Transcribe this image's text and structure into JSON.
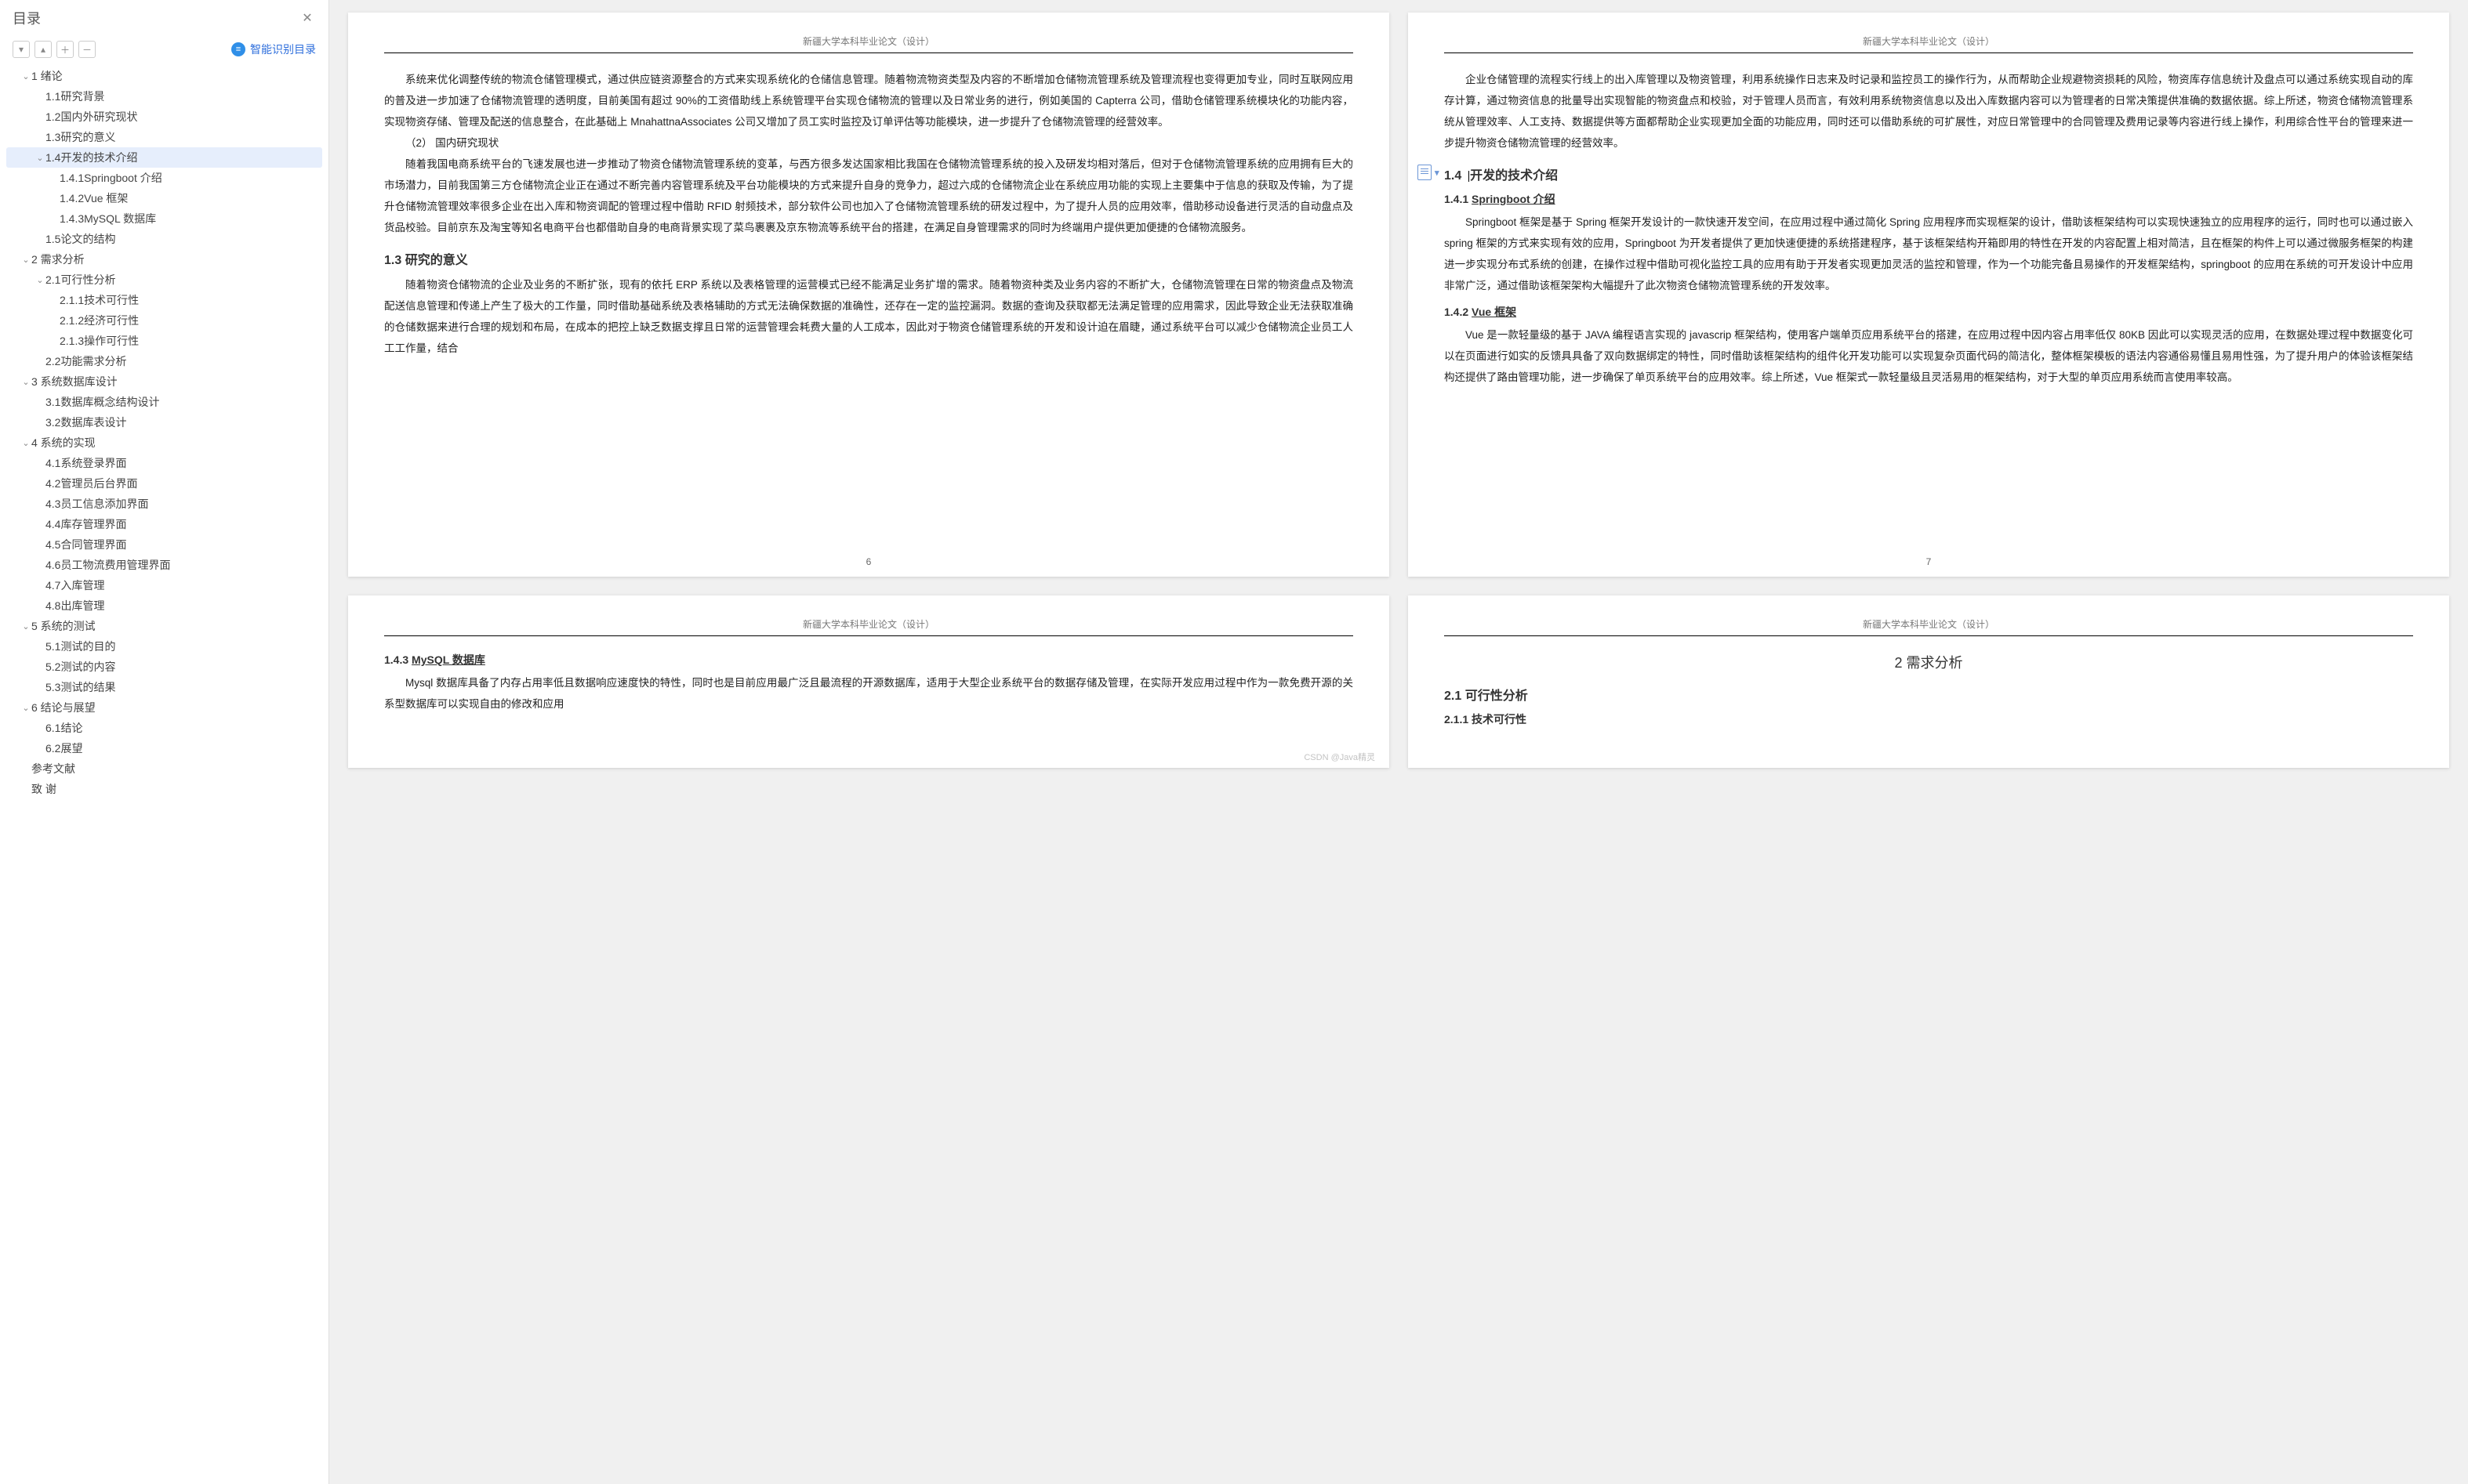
{
  "sidebar": {
    "title": "目录",
    "smart_toc": "智能识别目录",
    "tool_icons": [
      "collapse-all",
      "expand-all",
      "add",
      "remove"
    ],
    "items": [
      {
        "label": "1  绪论",
        "level": 0,
        "caret": "down"
      },
      {
        "label": "1.1研究背景",
        "level": 1
      },
      {
        "label": "1.2国内外研究现状",
        "level": 1
      },
      {
        "label": "1.3研究的意义",
        "level": 1
      },
      {
        "label": "1.4开发的技术介绍",
        "level": 1,
        "caret": "down",
        "selected": true
      },
      {
        "label": "1.4.1Springboot 介绍",
        "level": 2
      },
      {
        "label": "1.4.2Vue 框架",
        "level": 2
      },
      {
        "label": "1.4.3MySQL 数据库",
        "level": 2
      },
      {
        "label": "1.5论文的结构",
        "level": 1
      },
      {
        "label": "2  需求分析",
        "level": 0,
        "caret": "down"
      },
      {
        "label": "2.1可行性分析",
        "level": 1,
        "caret": "down"
      },
      {
        "label": "2.1.1技术可行性",
        "level": 2
      },
      {
        "label": "2.1.2经济可行性",
        "level": 2
      },
      {
        "label": "2.1.3操作可行性",
        "level": 2
      },
      {
        "label": "2.2功能需求分析",
        "level": 1
      },
      {
        "label": "3  系统数据库设计",
        "level": 0,
        "caret": "down"
      },
      {
        "label": "3.1数据库概念结构设计",
        "level": 1
      },
      {
        "label": "3.2数据库表设计",
        "level": 1
      },
      {
        "label": "4  系统的实现",
        "level": 0,
        "caret": "down"
      },
      {
        "label": "4.1系统登录界面",
        "level": 1
      },
      {
        "label": "4.2管理员后台界面",
        "level": 1
      },
      {
        "label": "4.3员工信息添加界面",
        "level": 1
      },
      {
        "label": "4.4库存管理界面",
        "level": 1
      },
      {
        "label": "4.5合同管理界面",
        "level": 1
      },
      {
        "label": "4.6员工物流费用管理界面",
        "level": 1
      },
      {
        "label": "4.7入库管理",
        "level": 1
      },
      {
        "label": "4.8出库管理",
        "level": 1
      },
      {
        "label": "5  系统的测试",
        "level": 0,
        "caret": "down"
      },
      {
        "label": "5.1测试的目的",
        "level": 1
      },
      {
        "label": "5.2测试的内容",
        "level": 1
      },
      {
        "label": "5.3测试的结果",
        "level": 1
      },
      {
        "label": "6  结论与展望",
        "level": 0,
        "caret": "down"
      },
      {
        "label": "6.1结论",
        "level": 1
      },
      {
        "label": "6.2展望",
        "level": 1
      },
      {
        "label": "参考文献",
        "level": 0
      },
      {
        "label": "致  谢",
        "level": 0
      }
    ]
  },
  "doc": {
    "running_header": "新疆大学本科毕业论文（设计）",
    "watermark": "CSDN @Java精灵",
    "p6": {
      "para1": "系统来优化调整传统的物流仓储管理模式，通过供应链资源整合的方式来实现系统化的仓储信息管理。随着物流物资类型及内容的不断增加仓储物流管理系统及管理流程也变得更加专业，同时互联网应用的普及进一步加速了仓储物流管理的透明度，目前美国有超过 90%的工资借助线上系统管理平台实现仓储物流的管理以及日常业务的进行，例如美国的 Capterra 公司，借助仓储管理系统模块化的功能内容，实现物资存储、管理及配送的信息整合，在此基础上 MnahattnaAssociates 公司又增加了员工实时监控及订单评估等功能模块，进一步提升了仓储物流管理的经营效率。",
      "h_domestic": "（2） 国内研究现状",
      "para2": "随着我国电商系统平台的飞速发展也进一步推动了物资仓储物流管理系统的变革，与西方很多发达国家相比我国在仓储物流管理系统的投入及研发均相对落后，但对于仓储物流管理系统的应用拥有巨大的市场潜力，目前我国第三方仓储物流企业正在通过不断完善内容管理系统及平台功能模块的方式来提升自身的竞争力，超过六成的仓储物流企业在系统应用功能的实现上主要集中于信息的获取及传输，为了提升仓储物流管理效率很多企业在出入库和物资调配的管理过程中借助 RFID 射频技术，部分软件公司也加入了仓储物流管理系统的研发过程中，为了提升人员的应用效率，借助移动设备进行灵活的自动盘点及货品校验。目前京东及淘宝等知名电商平台也都借助自身的电商背景实现了菜鸟裹裹及京东物流等系统平台的搭建，在满足自身管理需求的同时为终端用户提供更加便捷的仓储物流服务。",
      "h13": "1.3  研究的意义",
      "para3": "随着物资仓储物流的企业及业务的不断扩张，现有的依托 ERP 系统以及表格管理的运营模式已经不能满足业务扩增的需求。随着物资种类及业务内容的不断扩大，仓储物流管理在日常的物资盘点及物流配送信息管理和传递上产生了极大的工作量，同时借助基础系统及表格辅助的方式无法确保数据的准确性，还存在一定的监控漏洞。数据的查询及获取都无法满足管理的应用需求，因此导致企业无法获取准确的仓储数据来进行合理的规划和布局，在成本的把控上缺乏数据支撑且日常的运营管理会耗费大量的人工成本，因此对于物资仓储管理系统的开发和设计迫在眉睫，通过系统平台可以减少仓储物流企业员工人工工作量，结合",
      "pageNum": "6"
    },
    "p7": {
      "para1": "企业仓储管理的流程实行线上的出入库管理以及物资管理，利用系统操作日志来及时记录和监控员工的操作行为，从而帮助企业规避物资损耗的风险，物资库存信息统计及盘点可以通过系统实现自动的库存计算，通过物资信息的批量导出实现智能的物资盘点和校验，对于管理人员而言，有效利用系统物资信息以及出入库数据内容可以为管理者的日常决策提供准确的数据依据。综上所述，物资仓储物流管理系统从管理效率、人工支持、数据提供等方面都帮助企业实现更加全面的功能应用，同时还可以借助系统的可扩展性，对应日常管理中的合同管理及费用记录等内容进行线上操作，利用综合性平台的管理来进一步提升物资仓储物流管理的经营效率。",
      "h14": "1.4  开发的技术介绍",
      "h141_label": "1.4.1 ",
      "h141_underline": "Springboot 介绍",
      "para141": "Springboot 框架是基于 Spring 框架开发设计的一款快速开发空间，在应用过程中通过简化 Spring 应用程序而实现框架的设计，借助该框架结构可以实现快速独立的应用程序的运行，同时也可以通过嵌入 spring 框架的方式来实现有效的应用，Springboot 为开发者提供了更加快速便捷的系统搭建程序，基于该框架结构开箱即用的特性在开发的内容配置上相对简洁，且在框架的构件上可以通过微服务框架的构建进一步实现分布式系统的创建，在操作过程中借助可视化监控工具的应用有助于开发者实现更加灵活的监控和管理，作为一个功能完备且易操作的开发框架结构，springboot 的应用在系统的可开发设计中应用非常广泛，通过借助该框架架构大幅提升了此次物资仓储物流管理系统的开发效率。",
      "h142_label": "1.4.2 ",
      "h142_underline": "Vue 框架",
      "para142": "Vue 是一款轻量级的基于 JAVA 编程语言实现的 javascrip 框架结构，使用客户端单页应用系统平台的搭建，在应用过程中因内容占用率低仅 80KB 因此可以实现灵活的应用，在数据处理过程中数据变化可以在页面进行如实的反馈具具备了双向数据绑定的特性，同时借助该框架结构的组件化开发功能可以实现复杂页面代码的简洁化，整体框架模板的语法内容通俗易懂且易用性强，为了提升用户的体验该框架结构还提供了路由管理功能，进一步确保了单页系统平台的应用效率。综上所述，Vue 框架式一款轻量级且灵活易用的框架结构，对于大型的单页应用系统而言使用率较高。",
      "pageNum": "7"
    },
    "p8": {
      "h143_label": "1.4.3 ",
      "h143_underline": "MySQL 数据库",
      "para": "Mysql 数据库具备了内存占用率低且数据响应速度快的特性，同时也是目前应用最广泛且最流程的开源数据库，适用于大型企业系统平台的数据存储及管理，在实际开发应用过程中作为一款免费开源的关系型数据库可以实现自由的修改和应用"
    },
    "p9": {
      "h2": "2      需求分析",
      "h21": "2.1  可行性分析",
      "h211": "2.1.1  技术可行性"
    }
  }
}
